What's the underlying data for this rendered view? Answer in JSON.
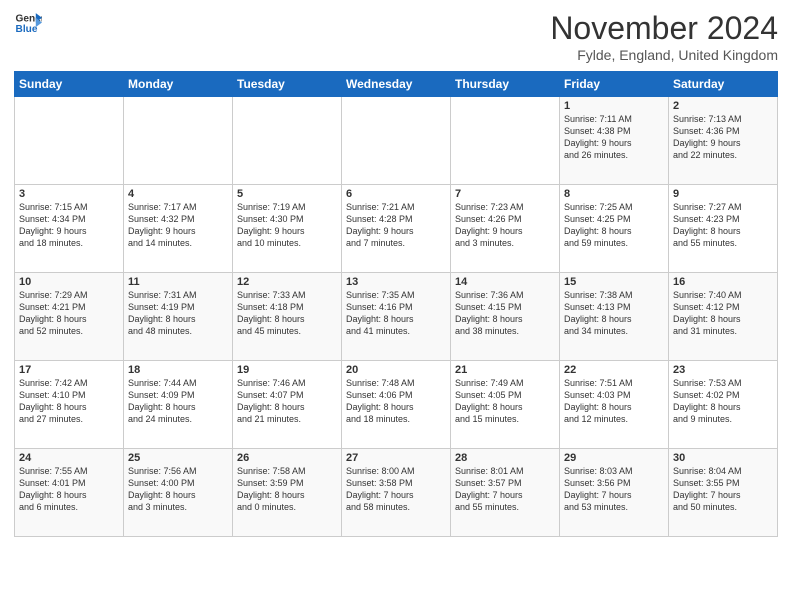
{
  "logo": {
    "line1": "General",
    "line2": "Blue"
  },
  "title": "November 2024",
  "subtitle": "Fylde, England, United Kingdom",
  "days_header": [
    "Sunday",
    "Monday",
    "Tuesday",
    "Wednesday",
    "Thursday",
    "Friday",
    "Saturday"
  ],
  "weeks": [
    [
      {
        "day": "",
        "info": ""
      },
      {
        "day": "",
        "info": ""
      },
      {
        "day": "",
        "info": ""
      },
      {
        "day": "",
        "info": ""
      },
      {
        "day": "",
        "info": ""
      },
      {
        "day": "1",
        "info": "Sunrise: 7:11 AM\nSunset: 4:38 PM\nDaylight: 9 hours\nand 26 minutes."
      },
      {
        "day": "2",
        "info": "Sunrise: 7:13 AM\nSunset: 4:36 PM\nDaylight: 9 hours\nand 22 minutes."
      }
    ],
    [
      {
        "day": "3",
        "info": "Sunrise: 7:15 AM\nSunset: 4:34 PM\nDaylight: 9 hours\nand 18 minutes."
      },
      {
        "day": "4",
        "info": "Sunrise: 7:17 AM\nSunset: 4:32 PM\nDaylight: 9 hours\nand 14 minutes."
      },
      {
        "day": "5",
        "info": "Sunrise: 7:19 AM\nSunset: 4:30 PM\nDaylight: 9 hours\nand 10 minutes."
      },
      {
        "day": "6",
        "info": "Sunrise: 7:21 AM\nSunset: 4:28 PM\nDaylight: 9 hours\nand 7 minutes."
      },
      {
        "day": "7",
        "info": "Sunrise: 7:23 AM\nSunset: 4:26 PM\nDaylight: 9 hours\nand 3 minutes."
      },
      {
        "day": "8",
        "info": "Sunrise: 7:25 AM\nSunset: 4:25 PM\nDaylight: 8 hours\nand 59 minutes."
      },
      {
        "day": "9",
        "info": "Sunrise: 7:27 AM\nSunset: 4:23 PM\nDaylight: 8 hours\nand 55 minutes."
      }
    ],
    [
      {
        "day": "10",
        "info": "Sunrise: 7:29 AM\nSunset: 4:21 PM\nDaylight: 8 hours\nand 52 minutes."
      },
      {
        "day": "11",
        "info": "Sunrise: 7:31 AM\nSunset: 4:19 PM\nDaylight: 8 hours\nand 48 minutes."
      },
      {
        "day": "12",
        "info": "Sunrise: 7:33 AM\nSunset: 4:18 PM\nDaylight: 8 hours\nand 45 minutes."
      },
      {
        "day": "13",
        "info": "Sunrise: 7:35 AM\nSunset: 4:16 PM\nDaylight: 8 hours\nand 41 minutes."
      },
      {
        "day": "14",
        "info": "Sunrise: 7:36 AM\nSunset: 4:15 PM\nDaylight: 8 hours\nand 38 minutes."
      },
      {
        "day": "15",
        "info": "Sunrise: 7:38 AM\nSunset: 4:13 PM\nDaylight: 8 hours\nand 34 minutes."
      },
      {
        "day": "16",
        "info": "Sunrise: 7:40 AM\nSunset: 4:12 PM\nDaylight: 8 hours\nand 31 minutes."
      }
    ],
    [
      {
        "day": "17",
        "info": "Sunrise: 7:42 AM\nSunset: 4:10 PM\nDaylight: 8 hours\nand 27 minutes."
      },
      {
        "day": "18",
        "info": "Sunrise: 7:44 AM\nSunset: 4:09 PM\nDaylight: 8 hours\nand 24 minutes."
      },
      {
        "day": "19",
        "info": "Sunrise: 7:46 AM\nSunset: 4:07 PM\nDaylight: 8 hours\nand 21 minutes."
      },
      {
        "day": "20",
        "info": "Sunrise: 7:48 AM\nSunset: 4:06 PM\nDaylight: 8 hours\nand 18 minutes."
      },
      {
        "day": "21",
        "info": "Sunrise: 7:49 AM\nSunset: 4:05 PM\nDaylight: 8 hours\nand 15 minutes."
      },
      {
        "day": "22",
        "info": "Sunrise: 7:51 AM\nSunset: 4:03 PM\nDaylight: 8 hours\nand 12 minutes."
      },
      {
        "day": "23",
        "info": "Sunrise: 7:53 AM\nSunset: 4:02 PM\nDaylight: 8 hours\nand 9 minutes."
      }
    ],
    [
      {
        "day": "24",
        "info": "Sunrise: 7:55 AM\nSunset: 4:01 PM\nDaylight: 8 hours\nand 6 minutes."
      },
      {
        "day": "25",
        "info": "Sunrise: 7:56 AM\nSunset: 4:00 PM\nDaylight: 8 hours\nand 3 minutes."
      },
      {
        "day": "26",
        "info": "Sunrise: 7:58 AM\nSunset: 3:59 PM\nDaylight: 8 hours\nand 0 minutes."
      },
      {
        "day": "27",
        "info": "Sunrise: 8:00 AM\nSunset: 3:58 PM\nDaylight: 7 hours\nand 58 minutes."
      },
      {
        "day": "28",
        "info": "Sunrise: 8:01 AM\nSunset: 3:57 PM\nDaylight: 7 hours\nand 55 minutes."
      },
      {
        "day": "29",
        "info": "Sunrise: 8:03 AM\nSunset: 3:56 PM\nDaylight: 7 hours\nand 53 minutes."
      },
      {
        "day": "30",
        "info": "Sunrise: 8:04 AM\nSunset: 3:55 PM\nDaylight: 7 hours\nand 50 minutes."
      }
    ]
  ]
}
